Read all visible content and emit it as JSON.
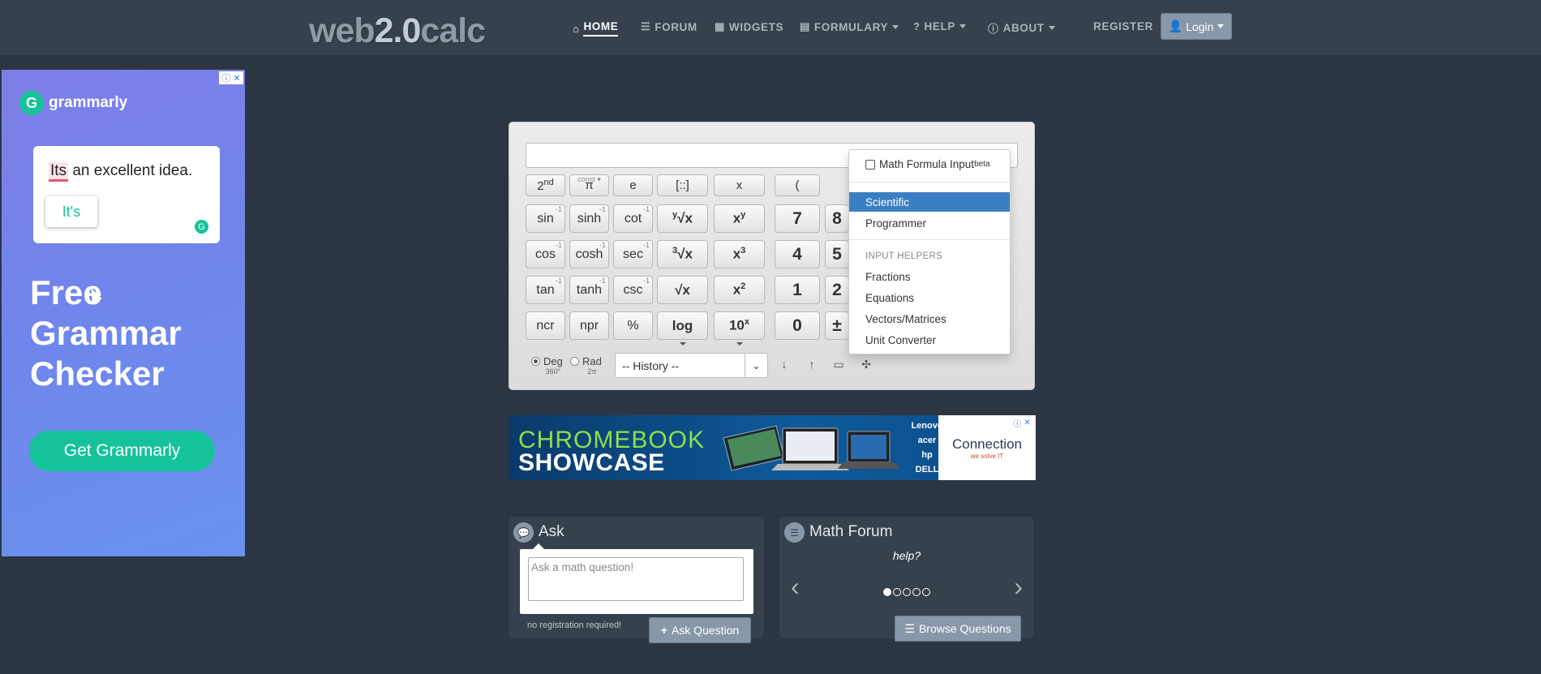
{
  "navbar": {
    "brand": {
      "part1": "web",
      "part2": "2.0",
      "part3": "calc"
    },
    "items": [
      {
        "label": "HOME",
        "icon": "home-icon",
        "active": true
      },
      {
        "label": "FORUM",
        "icon": "list-icon"
      },
      {
        "label": "WIDGETS",
        "icon": "calendar-icon"
      },
      {
        "label": "FORMULARY",
        "icon": "book-icon",
        "dropdown": true
      },
      {
        "label": "HELP",
        "icon": "question-icon",
        "dropdown": true
      },
      {
        "label": "ABOUT",
        "icon": "info-icon",
        "dropdown": true
      }
    ],
    "register": "REGISTER",
    "login": "Login"
  },
  "ad_left": {
    "brand": "grammarly",
    "sentence_word": "Its",
    "sentence_rest": " an excellent idea.",
    "suggestion": "It's",
    "headline": [
      "Free",
      "Grammar",
      "Checker"
    ],
    "cta": "Get Grammarly"
  },
  "calculator": {
    "keys": {
      "row0": [
        "2nd",
        "π",
        "e",
        "[::]",
        "x",
        "("
      ],
      "const_label": "const",
      "row1": [
        "sin",
        "sinh",
        "cot"
      ],
      "row2": [
        "cos",
        "cosh",
        "sec"
      ],
      "row3": [
        "tan",
        "tanh",
        "csc"
      ],
      "row4": [
        "ncr",
        "npr",
        "%",
        "log"
      ],
      "digits": [
        "7",
        "8",
        "4",
        "5",
        "1",
        "2",
        "0",
        "±"
      ],
      "sqrt": "√x",
      "inv_mark": "-1"
    },
    "angle": {
      "deg": "Deg",
      "deg_sub": "360°",
      "rad": "Rad",
      "rad_sub": "2π",
      "selected": "Deg"
    },
    "history_placeholder": "-- History --"
  },
  "mode_menu": {
    "formula_input": "Math Formula Input",
    "formula_badge": "beta",
    "modes": [
      {
        "label": "Scientific",
        "selected": true
      },
      {
        "label": "Programmer",
        "selected": false
      }
    ],
    "helpers_header": "INPUT HELPERS",
    "helpers": [
      "Fractions",
      "Equations",
      "Vectors/Matrices",
      "Unit Converter"
    ]
  },
  "ad_bottom": {
    "line1": "CHROMEBOOK",
    "line2": "SHOWCASE",
    "brands": [
      "Lenovo",
      "acer",
      "hp",
      "DELL"
    ],
    "advertiser": "Connection",
    "tagline": "we solve IT"
  },
  "ask": {
    "title": "Ask",
    "placeholder": "Ask a math question!",
    "note": "no registration required!",
    "button": "Ask Question"
  },
  "forum": {
    "title": "Math Forum",
    "question": "help?",
    "slides": 5,
    "active_slide": 1,
    "button": "Browse Questions"
  },
  "colors": {
    "background": "#2c3642",
    "navbar": "#36414d",
    "selected": "#3a7fc1",
    "grammarly_green": "#15c39a"
  }
}
